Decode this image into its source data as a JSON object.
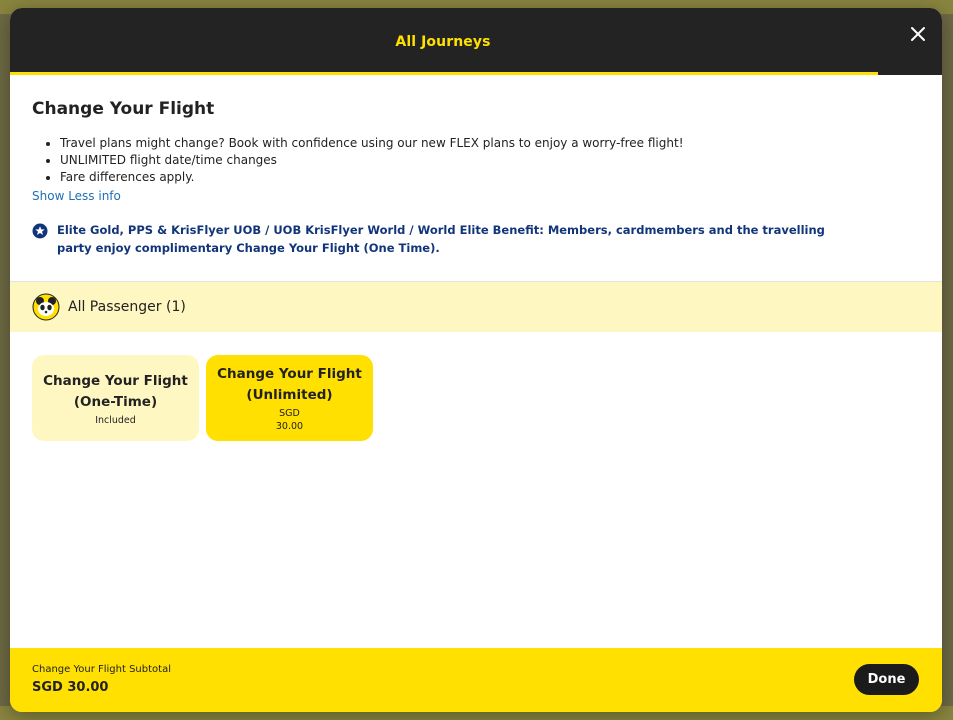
{
  "modal": {
    "title": "All Journeys",
    "close_icon": "close-icon"
  },
  "change_flight": {
    "heading": "Change Your Flight",
    "bullets": [
      "Travel plans might change? Book with confidence using our new FLEX plans to enjoy a worry-free flight!",
      "UNLIMITED flight date/time changes",
      "Fare differences apply."
    ],
    "show_less_label": "Show Less info",
    "benefit_icon": "star-badge-icon",
    "benefit_text": "Elite Gold, PPS & KrisFlyer UOB / UOB KrisFlyer World / World Elite Benefit: Members, cardmembers and the travelling party enjoy complimentary Change Your Flight (One Time)."
  },
  "passenger": {
    "icon": "passenger-mascot-icon",
    "label": "All Passenger (1)"
  },
  "options": [
    {
      "title_line1": "Change Your Flight",
      "title_line2": "(One-Time)",
      "subtitle": "Included",
      "amount": ""
    },
    {
      "title_line1": "Change Your Flight",
      "title_line2": "(Unlimited)",
      "subtitle": "SGD",
      "amount": "30.00"
    }
  ],
  "footer": {
    "subtotal_label": "Change Your Flight Subtotal",
    "subtotal_value": "SGD 30.00",
    "done_label": "Done"
  },
  "colors": {
    "brand_yellow": "#ffe000",
    "header_dark": "#232323",
    "light_yellow": "#fff7c2",
    "link_blue": "#1f6fb5",
    "benefit_navy": "#12357a"
  }
}
